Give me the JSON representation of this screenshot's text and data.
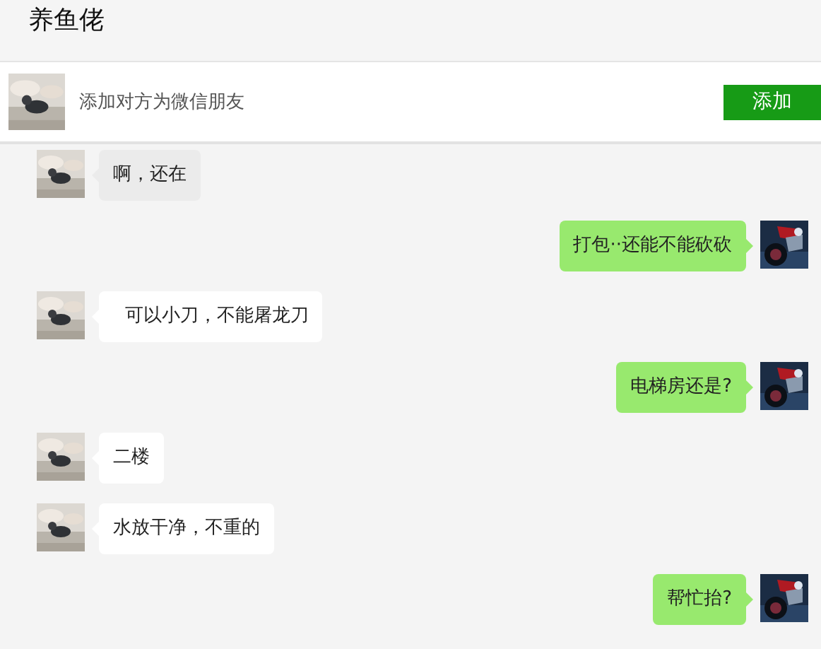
{
  "window": {
    "title": "养鱼佬"
  },
  "add_friend_bar": {
    "text": "添加对方为微信朋友",
    "button": "添加"
  },
  "messages": [
    {
      "kind": "received",
      "text": "啊，还在",
      "selected": true
    },
    {
      "kind": "sent",
      "text": "打包··还能不能砍砍",
      "selected": false
    },
    {
      "kind": "received",
      "text": "  可以小刀，不能屠龙刀",
      "selected": false
    },
    {
      "kind": "sent",
      "text": "电梯房还是?",
      "selected": false
    },
    {
      "kind": "received",
      "text": "二楼",
      "selected": false
    },
    {
      "kind": "received",
      "text": "水放干净，不重的",
      "selected": false
    },
    {
      "kind": "sent",
      "text": "帮忙抬?",
      "selected": false
    }
  ]
}
